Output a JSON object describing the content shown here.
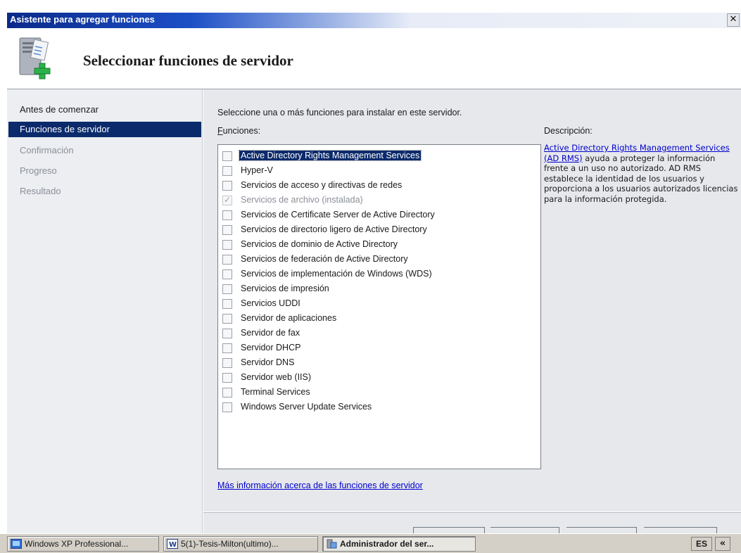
{
  "window": {
    "title": "Asistente para agregar funciones",
    "close_glyph": "✕"
  },
  "header": {
    "title": "Seleccionar funciones de servidor",
    "icon": "server-add-icon"
  },
  "nav": {
    "items": [
      {
        "label": "Antes de comenzar",
        "state": "normal"
      },
      {
        "label": "Funciones de servidor",
        "state": "active"
      },
      {
        "label": "Confirmación",
        "state": "disabled"
      },
      {
        "label": "Progreso",
        "state": "disabled"
      },
      {
        "label": "Resultado",
        "state": "disabled"
      }
    ]
  },
  "main": {
    "instruction": "Seleccione una o más funciones para instalar en este servidor.",
    "roles_label_first": "F",
    "roles_label_rest": "unciones:",
    "description_label": "Descripción:",
    "description_link": "Active Directory Rights Management Services (AD RMS)",
    "description_text": " ayuda a proteger la información frente a un uso no autorizado. AD RMS establece la identidad de los usuarios y proporciona a los usuarios autorizados licencias para la información protegida.",
    "more_info_link": "Más información acerca de las funciones de servidor",
    "roles": [
      {
        "label": "Active Directory Rights Management Services",
        "checked": false,
        "state": "selected"
      },
      {
        "label": "Hyper-V",
        "checked": false,
        "state": "normal"
      },
      {
        "label": "Servicios de acceso y directivas de redes",
        "checked": false,
        "state": "normal"
      },
      {
        "label": "Servicios de archivo (instalada)",
        "checked": true,
        "state": "disabled"
      },
      {
        "label": "Servicios de Certificate Server de Active Directory",
        "checked": false,
        "state": "normal"
      },
      {
        "label": "Servicios de directorio ligero de Active Directory",
        "checked": false,
        "state": "normal"
      },
      {
        "label": "Servicios de dominio de Active Directory",
        "checked": false,
        "state": "normal"
      },
      {
        "label": "Servicios de federación de Active Directory",
        "checked": false,
        "state": "normal"
      },
      {
        "label": "Servicios de implementación de Windows (WDS)",
        "checked": false,
        "state": "normal"
      },
      {
        "label": "Servicios de impresión",
        "checked": false,
        "state": "normal"
      },
      {
        "label": "Servicios UDDI",
        "checked": false,
        "state": "normal"
      },
      {
        "label": "Servidor de aplicaciones",
        "checked": false,
        "state": "normal"
      },
      {
        "label": "Servidor de fax",
        "checked": false,
        "state": "normal"
      },
      {
        "label": "Servidor DHCP",
        "checked": false,
        "state": "normal"
      },
      {
        "label": "Servidor DNS",
        "checked": false,
        "state": "normal"
      },
      {
        "label": "Servidor web (IIS)",
        "checked": false,
        "state": "normal"
      },
      {
        "label": "Terminal Services",
        "checked": false,
        "state": "normal"
      },
      {
        "label": "Windows Server Update Services",
        "checked": false,
        "state": "normal"
      }
    ]
  },
  "taskbar": {
    "tasks": [
      {
        "label": "Windows XP Professional...",
        "icon": "vm-icon"
      },
      {
        "label": "5(1)-Tesis-Milton(ultimo)...",
        "icon": "word-icon"
      },
      {
        "label": "Administrador del ser...",
        "icon": "server-manager-icon"
      }
    ],
    "language": "ES",
    "expand_glyph": "«"
  },
  "colors": {
    "selection": "#0b2a6b",
    "link": "#0000cc",
    "nav_bg": "#eceef2",
    "content_bg": "#e6e8ec"
  }
}
